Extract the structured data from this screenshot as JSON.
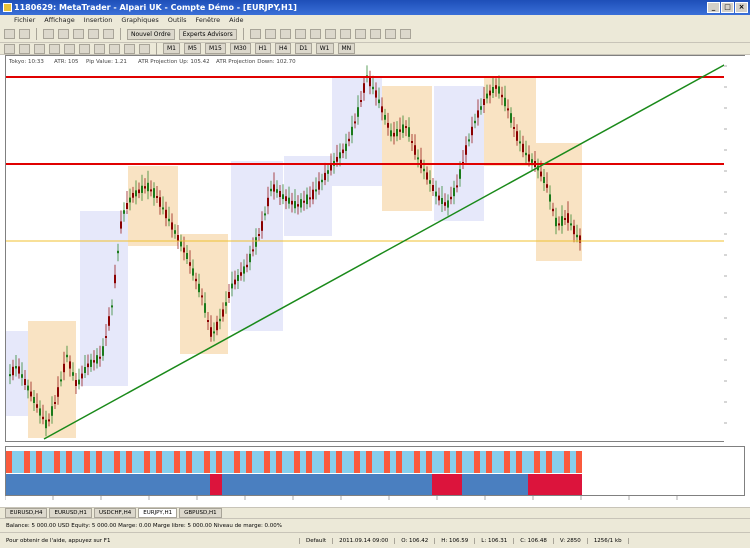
{
  "window": {
    "title": "1180629: MetaTrader - Alpari UK - Compte Démo - [EURJPY,H1]"
  },
  "menu": [
    "Fichier",
    "Affichage",
    "Insertion",
    "Graphiques",
    "Outils",
    "Fenêtre",
    "Aide"
  ],
  "toolbar": {
    "new_order_label": "Nouvel Ordre",
    "expert_label": "Experts Advisors",
    "timeframes": [
      "M1",
      "M5",
      "M15",
      "M30",
      "H1",
      "H4",
      "D1",
      "W1",
      "MN"
    ]
  },
  "chart": {
    "symbol": "EURJPY,H1",
    "header_items": [
      "Tokyo: 10:33",
      "ATR: 105",
      "Pip Value: 1.21",
      "ATR Projection Up: 105.42",
      "ATR Projection Down: 102.70"
    ],
    "lines": {
      "resistance_color": "#e00000",
      "support_color": "#1a8a1a",
      "level_color": "#f0c030"
    }
  },
  "indicator": {
    "colors": {
      "up": "#87ceeb",
      "down": "#fa5a3c",
      "blue": "#4a7fc0",
      "red": "#dc143c"
    }
  },
  "tabs": [
    "EURUSD,H4",
    "EURUSD,H1",
    "USDCHF,H4",
    "EURJPY,H1",
    "GBPUSD,H1"
  ],
  "active_tab": "EURJPY,H1",
  "terminal": {
    "text": "Balance: 5 000.00 USD  Equity: 5 000.00  Marge: 0.00  Marge libre: 5 000.00  Niveau de marge: 0.00%"
  },
  "status": {
    "help": "Pour obtenir de l'aide, appuyez sur F1",
    "profile": "Default",
    "datetime": "2011.09.14 09:00",
    "open": "O: 106.42",
    "high": "H: 106.59",
    "low": "L: 106.31",
    "close": "C: 106.48",
    "volume": "V: 2850",
    "kb": "1256/1 kb"
  }
}
